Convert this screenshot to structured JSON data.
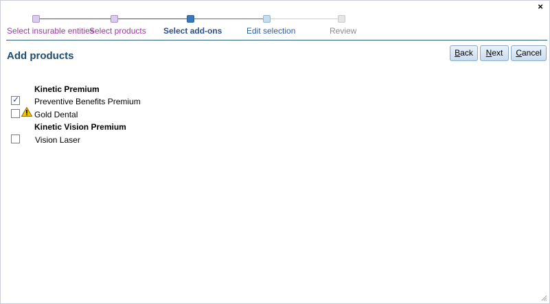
{
  "window": {
    "close_glyph": "×"
  },
  "stepper": {
    "steps": [
      {
        "label": "Select insurable entities",
        "state": "done"
      },
      {
        "label": "Select products",
        "state": "done"
      },
      {
        "label": "Select add-ons",
        "state": "current"
      },
      {
        "label": "Edit selection",
        "state": "next"
      },
      {
        "label": "Review",
        "state": "future"
      }
    ]
  },
  "header": {
    "title": "Add products"
  },
  "buttons": {
    "back": {
      "hotkey": "B",
      "rest": "ack"
    },
    "next": {
      "hotkey": "N",
      "rest": "ext"
    },
    "cancel": {
      "hotkey": "C",
      "rest": "ancel"
    }
  },
  "groups": [
    {
      "title": "Kinetic Premium",
      "items": [
        {
          "label": "Preventive Benefits Premium",
          "checked": true,
          "warning": false
        },
        {
          "label": "Gold Dental",
          "checked": false,
          "warning": true
        }
      ]
    },
    {
      "title": "Kinetic Vision Premium",
      "items": [
        {
          "label": "Vision Laser",
          "checked": false,
          "warning": false
        }
      ]
    }
  ],
  "colors": {
    "title": "#1e4a6e",
    "step_done": "#9a3a9a",
    "step_current": "#2b4f8a",
    "warning": "#f5c400"
  }
}
